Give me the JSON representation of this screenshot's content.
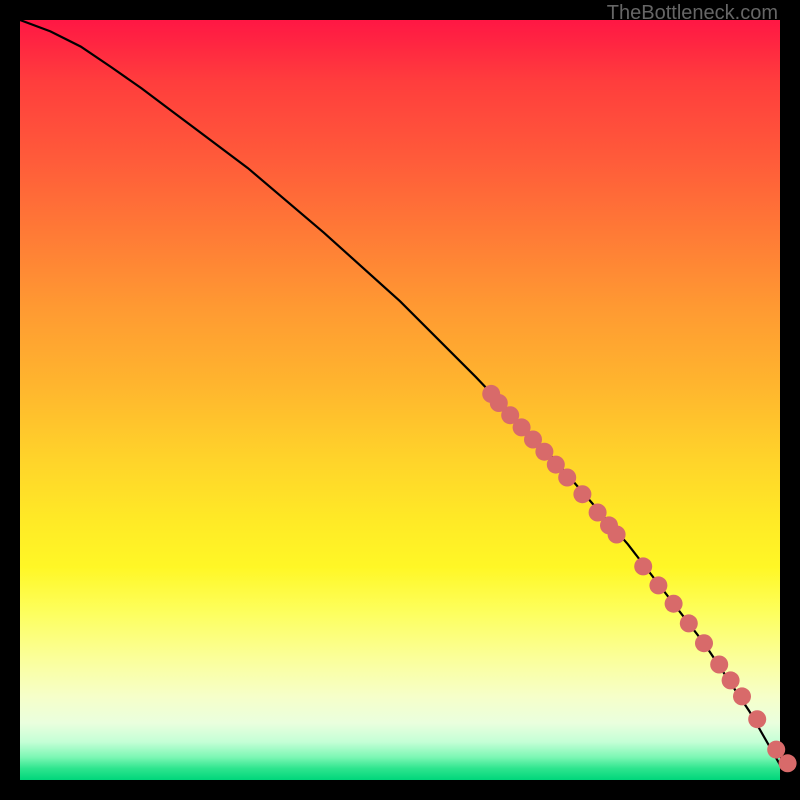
{
  "watermark": "TheBottleneck.com",
  "chart_data": {
    "type": "line",
    "title": "",
    "xlabel": "",
    "ylabel": "",
    "xlim": [
      0,
      100
    ],
    "ylim": [
      0,
      100
    ],
    "grid": false,
    "legend": false,
    "series": [
      {
        "name": "curve",
        "type": "line",
        "color": "#000000",
        "x": [
          0,
          4,
          8,
          12,
          16,
          20,
          30,
          40,
          50,
          60,
          70,
          80,
          90,
          96,
          100
        ],
        "y": [
          100,
          98.5,
          96.5,
          93.8,
          91,
          88,
          80.5,
          72,
          63,
          53,
          42.5,
          31,
          18,
          9,
          2
        ]
      },
      {
        "name": "cluster-upper",
        "type": "scatter",
        "color": "#d86a6a",
        "x": [
          62,
          63,
          64.5,
          66,
          67.5,
          69,
          70.5,
          72,
          74,
          76,
          77.5,
          78.5
        ],
        "y": [
          50.8,
          49.6,
          48.0,
          46.4,
          44.8,
          43.2,
          41.5,
          39.8,
          37.6,
          35.2,
          33.5,
          32.3
        ]
      },
      {
        "name": "cluster-lower",
        "type": "scatter",
        "color": "#d86a6a",
        "x": [
          82,
          84,
          86,
          88,
          90,
          92,
          93.5,
          95,
          97,
          99.5,
          101
        ],
        "y": [
          28.1,
          25.6,
          23.2,
          20.6,
          18.0,
          15.2,
          13.1,
          11.0,
          8.0,
          4.0,
          2.2
        ]
      }
    ]
  }
}
